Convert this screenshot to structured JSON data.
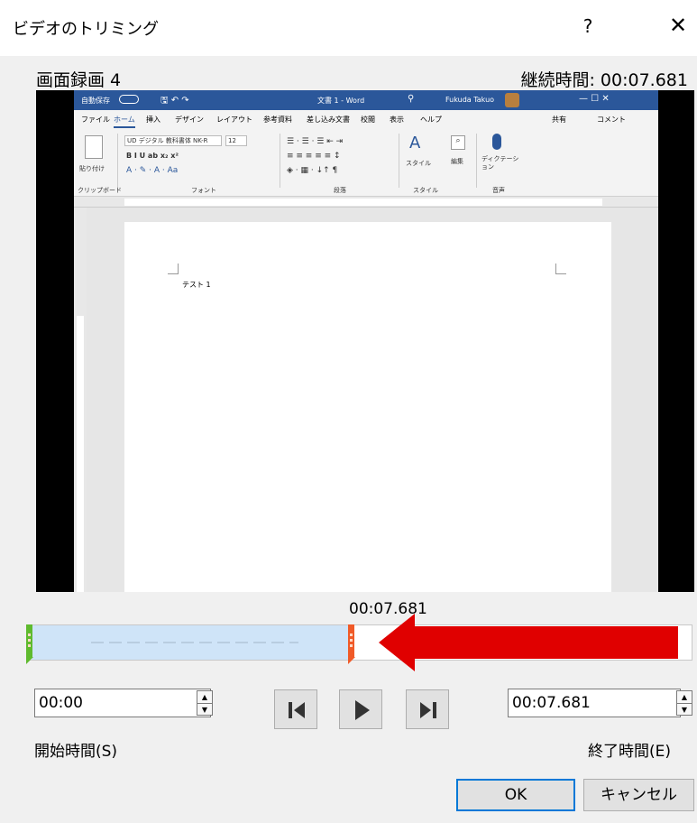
{
  "dialog": {
    "title": "ビデオのトリミング",
    "help": "?",
    "close": "✕"
  },
  "video": {
    "name": "画面録画 4",
    "duration_label": "継続時間: 00:07.681",
    "playhead_time": "00:07.681",
    "selection_end_fraction": 0.48
  },
  "word_screenshot": {
    "autosave": "自動保存",
    "doc_title": "文書 1 - Word",
    "user": "Fukuda Takuo",
    "tabs": [
      "ファイル",
      "ホーム",
      "挿入",
      "デザイン",
      "レイアウト",
      "参考資料",
      "差し込み文書",
      "校閲",
      "表示",
      "ヘルプ"
    ],
    "share": "共有",
    "comment": "コメント",
    "font_name": "UD デジタル 教科書体 NK-R",
    "font_size": "12",
    "groups": [
      "クリップボード",
      "フォント",
      "段落",
      "スタイル",
      "音声"
    ],
    "paste": "貼り付け",
    "style": "スタイル",
    "edit": "編集",
    "dictate": "ディクテーション",
    "body_text": "テスト 1"
  },
  "start": {
    "value": "00:00",
    "label": "開始時間(S)"
  },
  "end": {
    "value": "00:07.681",
    "label": "終了時間(E)"
  },
  "buttons": {
    "ok": "OK",
    "cancel": "キャンセル"
  },
  "colors": {
    "start_handle": "#5fba2e",
    "end_handle": "#f05a28",
    "arrow": "#e00000",
    "selection": "#cfe4f8",
    "word_blue": "#2b579a"
  }
}
